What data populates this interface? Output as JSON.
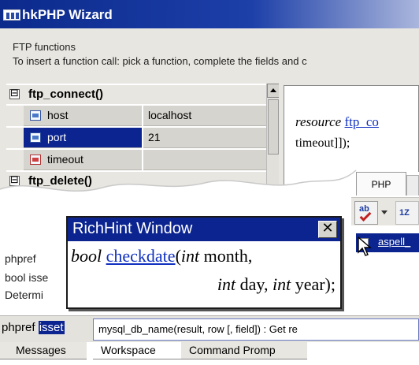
{
  "wizard": {
    "title": "hkPHP Wizard",
    "description_heading": "FTP functions",
    "description_text": "To insert a function call: pick a function, complete the fields and c",
    "functions": [
      {
        "name": "ftp_connect()",
        "expander": "⊟",
        "params": [
          {
            "name": "host",
            "value": "localhost",
            "icon": "param-icon",
            "selected": false
          },
          {
            "name": "port",
            "value": "21",
            "icon": "param-icon",
            "selected": true
          },
          {
            "name": "timeout",
            "value": "",
            "icon": "param-icon",
            "selected": false
          }
        ]
      },
      {
        "name": "ftp_delete()",
        "expander": "⊟",
        "params": []
      }
    ],
    "preview": {
      "return_type": "resource",
      "function_link": "ftp_co",
      "line2": "timeout]]);"
    }
  },
  "editor": {
    "tab_label": "PHP",
    "toolbar": {
      "spell_button_icon": "spellcheck-icon",
      "second_button_icon": "sort-icon"
    },
    "menu_item_label": "aspell_",
    "left_text": [
      "phpref",
      "bool isse",
      "Determi"
    ]
  },
  "richhint": {
    "title": "RichHint Window",
    "close_label": "✕",
    "sig": {
      "ret": "bool",
      "func": "checkdate",
      "open": "(",
      "t1": "int",
      "a1": " month,",
      "t2": "int",
      "a2": " day, ",
      "t3": "int",
      "a3": " year);"
    }
  },
  "statusbar": {
    "prefix": "phpref ",
    "highlight": "isset",
    "hint_text": "mysql_db_name(result, row [, field]) : Get re"
  },
  "bottom_tabs": [
    {
      "label": "Messages",
      "selected": false
    },
    {
      "label": "Workspace",
      "selected": true
    },
    {
      "label": "Command Promp",
      "selected": false
    }
  ],
  "colors": {
    "titlebar": "#0c2a8c",
    "selection": "#0b2490",
    "link": "#1030c0",
    "panel": "#e8e6e0"
  }
}
